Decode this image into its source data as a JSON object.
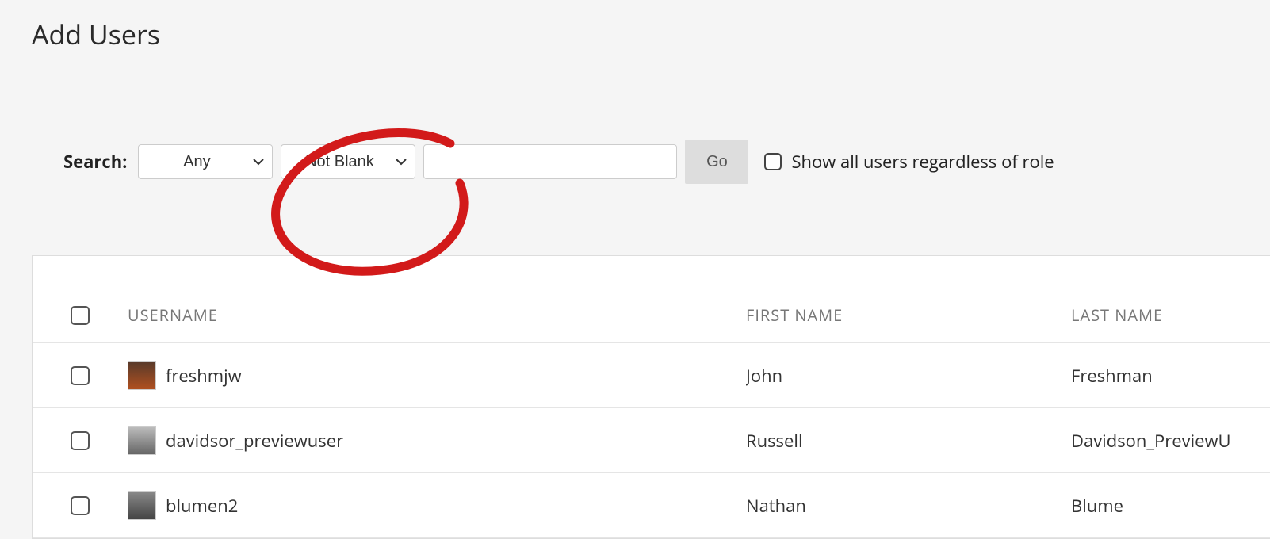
{
  "title": "Add Users",
  "search": {
    "label": "Search:",
    "field_selected": "Any",
    "condition_selected": "Not Blank",
    "text_value": "",
    "go_label": "Go",
    "show_all_label": "Show all users regardless of role",
    "show_all_checked": false
  },
  "table": {
    "headers": {
      "username": "USERNAME",
      "first_name": "FIRST NAME",
      "last_name": "LAST NAME"
    },
    "rows": [
      {
        "username": "freshmjw",
        "first_name": "John",
        "last_name": "Freshman"
      },
      {
        "username": "davidsor_previewuser",
        "first_name": "Russell",
        "last_name": "Davidson_PreviewU"
      },
      {
        "username": "blumen2",
        "first_name": "Nathan",
        "last_name": "Blume"
      }
    ]
  }
}
